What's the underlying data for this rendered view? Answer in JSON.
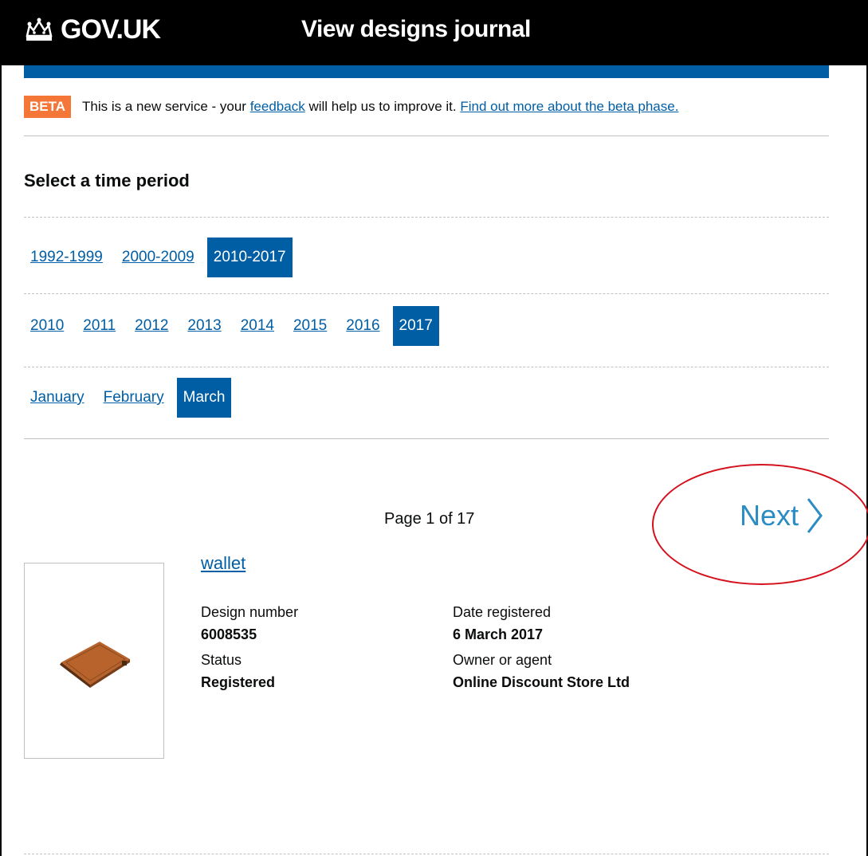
{
  "header": {
    "brand": "GOV.UK",
    "service_name": "View designs journal"
  },
  "beta_banner": {
    "tag": "BETA",
    "text_before": "This is a new service - your",
    "feedback_link": "feedback",
    "text_after": "will help us to improve it.",
    "more_link": "Find out more about the beta phase."
  },
  "filters": {
    "title": "Select a time period",
    "periods": [
      {
        "label": "1992-1999",
        "active": false
      },
      {
        "label": "2000-2009",
        "active": false
      },
      {
        "label": "2010-2017",
        "active": true
      }
    ],
    "years": [
      {
        "label": "2010",
        "active": false
      },
      {
        "label": "2011",
        "active": false
      },
      {
        "label": "2012",
        "active": false
      },
      {
        "label": "2013",
        "active": false
      },
      {
        "label": "2014",
        "active": false
      },
      {
        "label": "2015",
        "active": false
      },
      {
        "label": "2016",
        "active": false
      },
      {
        "label": "2017",
        "active": true
      }
    ],
    "months": [
      {
        "label": "January",
        "active": false
      },
      {
        "label": "February",
        "active": false
      },
      {
        "label": "March",
        "active": true
      }
    ]
  },
  "pagination": {
    "page_info": "Page 1 of 17",
    "next_label": "Next"
  },
  "result": {
    "title": "wallet",
    "design_number_label": "Design number",
    "design_number": "6008535",
    "date_registered_label": "Date registered",
    "date_registered": "6 March 2017",
    "status_label": "Status",
    "status": "Registered",
    "owner_label": "Owner or agent",
    "owner": "Online Discount Store Ltd"
  },
  "colors": {
    "header_bg": "#000000",
    "brand_blue": "#005ea5",
    "beta_orange": "#f47738",
    "annotation_red": "#d4111d"
  },
  "icons": {
    "crown": "crown-icon",
    "next_arrow": "chevron-right-icon",
    "wallet": "wallet-image"
  }
}
